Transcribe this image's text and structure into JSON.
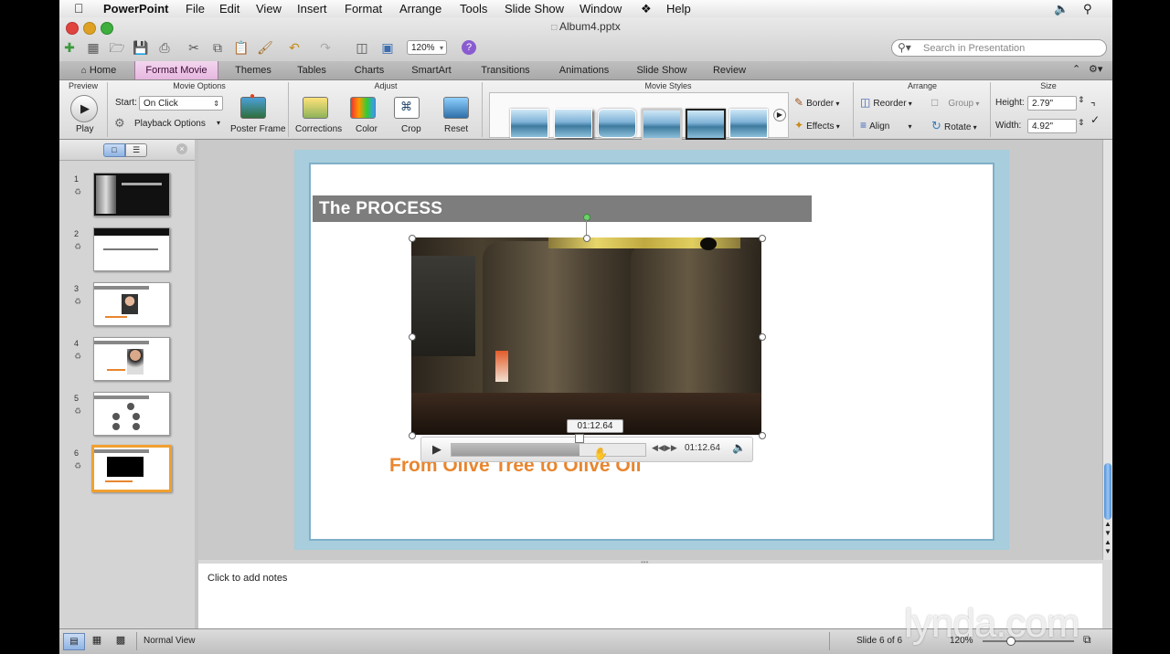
{
  "menubar": {
    "app_name": "PowerPoint",
    "items": [
      "File",
      "Edit",
      "View",
      "Insert",
      "Format",
      "Arrange",
      "Tools",
      "Slide Show",
      "Window",
      "Help"
    ]
  },
  "titlebar": {
    "document_title": "Album4.pptx",
    "zoom": "120%",
    "search_placeholder": "Search in Presentation"
  },
  "ribbon_tabs": [
    "Home",
    "Format Movie",
    "Themes",
    "Tables",
    "Charts",
    "SmartArt",
    "Transitions",
    "Animations",
    "Slide Show",
    "Review"
  ],
  "active_tab": "Format Movie",
  "ribbon": {
    "groups": {
      "preview": "Preview",
      "movie_options": "Movie Options",
      "adjust": "Adjust",
      "movie_styles": "Movie Styles",
      "arrange": "Arrange",
      "size": "Size"
    },
    "play_label": "Play",
    "start_label": "Start:",
    "start_value": "On Click",
    "playback_options": "Playback Options",
    "poster_frame": "Poster Frame",
    "corrections": "Corrections",
    "color": "Color",
    "crop": "Crop",
    "reset": "Reset",
    "border": "Border",
    "effects": "Effects",
    "reorder": "Reorder",
    "align": "Align",
    "group": "Group",
    "rotate": "Rotate",
    "height_label": "Height:",
    "height_value": "2.79\"",
    "width_label": "Width:",
    "width_value": "4.92\""
  },
  "slides": [
    {
      "number": "1"
    },
    {
      "number": "2"
    },
    {
      "number": "3"
    },
    {
      "number": "4"
    },
    {
      "number": "5"
    },
    {
      "number": "6"
    }
  ],
  "selected_slide": 6,
  "slide": {
    "title": "The PROCESS",
    "subtitle": "From Olive Tree to Olive Oil",
    "video_tooltip_time": "01:12.64",
    "video_time": "01:12.64",
    "video_progress": 0.66
  },
  "notes_placeholder": "Click to add notes",
  "statusbar": {
    "view_name": "Normal View",
    "slide_counter": "Slide 6 of 6",
    "zoom": "120%"
  },
  "watermark": "lynda.com",
  "colors": {
    "active_tab": "#e6b7df",
    "title_bar": "#7d7d7d",
    "subtitle": "#e8862f",
    "selected_thumb": "#f0a030"
  }
}
